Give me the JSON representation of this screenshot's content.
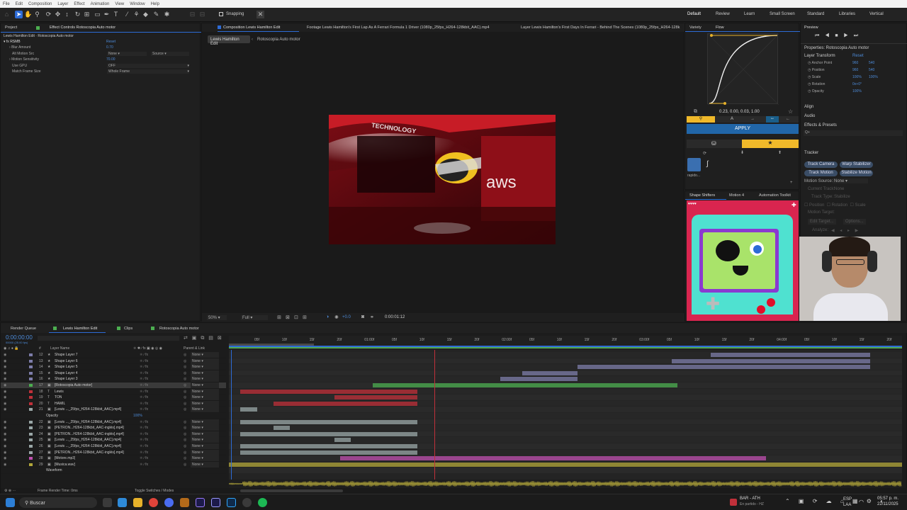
{
  "menu": [
    "File",
    "Edit",
    "Composition",
    "Layer",
    "Effect",
    "Animation",
    "View",
    "Window",
    "Help"
  ],
  "toolbar": {
    "snapping_label": "Snapping"
  },
  "workspaces": [
    "Default",
    "Review",
    "Learn",
    "Small Screen",
    "Standard",
    "Libraries",
    "Vertical"
  ],
  "project_panel": {
    "tab_project": "Project",
    "tab_effect_controls": "Effect Controls Rotoscopia Auto motor",
    "header": "Lewis Hamilton Edit · Rotoscopia Auto motor",
    "effect_name": "RSMB",
    "reset_label": "Reset",
    "props": [
      {
        "name": "Blur Amount",
        "value": "0.70"
      },
      {
        "name": "Alt Motion Src",
        "value": "None",
        "value2": "Source"
      },
      {
        "name": "Motion Sensitivity",
        "value": "70.00"
      },
      {
        "name": "Use GPU",
        "value": "OFF"
      },
      {
        "name": "Match Frame Size",
        "value": "Whole Frame"
      }
    ]
  },
  "comp_panel": {
    "tabs": [
      "Composition Lewis Hamilton Edit",
      "Footage Lewis Hamilton's First Lap As A Ferrari Formula 1 Driver (1080p_25fps_H264-128kbit_AAC).mp4",
      "Layer Lewis Hamilton's First Days In Ferrari - Behind The Scenes (1080p_25fps_H264-128k"
    ],
    "sub_tabs": [
      "Lewis Hamilton Edit",
      "Rotoscopia Auto motor"
    ],
    "image_text_top": "TECHNOLOGY",
    "image_text_logo": "aws",
    "zoom": "50%",
    "quality": "Full",
    "exposure": "+0.0",
    "timecode": "0:00:01:12"
  },
  "flow_panel": {
    "tabs": [
      "Variety",
      "Flow"
    ],
    "curve_values": "0.23, 0.00, 0.03, 1.00",
    "apply_label": "APPLY",
    "preset_label": "rapido...",
    "bottom_tabs": [
      "Shape Shifters",
      "Motion 4",
      "Automation Toolkit"
    ]
  },
  "preview_panel": {
    "tab_preview": "Preview",
    "properties_title": "Properties: Rotoscopia Auto motor",
    "layer_transform": "Layer Transform",
    "reset_label": "Reset",
    "transform": [
      {
        "name": "Anchor Point",
        "v1": "960",
        "v2": "540"
      },
      {
        "name": "Position",
        "v1": "960",
        "v2": "540"
      },
      {
        "name": "Scale",
        "v1": "100%",
        "v2": "100%"
      },
      {
        "name": "Rotation",
        "v1": "0x+0°",
        "v2": ""
      },
      {
        "name": "Opacity",
        "v1": "100%",
        "v2": ""
      }
    ],
    "sections": [
      "Align",
      "Audio",
      "Effects & Presets"
    ],
    "search_placeholder": "Q+",
    "tracker_title": "Tracker",
    "tracker_buttons": [
      "Track Camera",
      "Warp Stabilizer",
      "Track Motion",
      "Stabilize Motion"
    ],
    "motion_source_label": "Motion Source:",
    "motion_source_value": "None",
    "current_track_label": "Current Track:",
    "current_track_value": "None",
    "track_type_label": "Track Type:",
    "track_type_value": "Stabilize",
    "checks": [
      "Position",
      "Rotation",
      "Scale"
    ],
    "motion_target": "Motion Target:",
    "edit_target": "Edit Target...",
    "options": "Options...",
    "analyze": "Analyze:"
  },
  "timeline": {
    "tabs": [
      "Render Queue",
      "Lewis Hamilton Edit",
      "Clips",
      "Rotoscopia Auto motor"
    ],
    "timecode": "0:00:00:00",
    "timecode_sub": "00000 (25.00 fps)",
    "col_layer": "Layer Name",
    "col_parent": "Parent & Link",
    "ruler": [
      "05f",
      "10f",
      "15f",
      "20f",
      "01:00f",
      "05f",
      "10f",
      "15f",
      "20f",
      "02:00f",
      "05f",
      "10f",
      "15f",
      "20f",
      "03:00f",
      "05f",
      "10f",
      "15f",
      "20f",
      "04:00f",
      "05f",
      "10f",
      "15f",
      "20f"
    ],
    "layers": [
      {
        "num": "12",
        "icon": "★",
        "name": "Shape Layer 7",
        "parent": "None",
        "color": "#7d7daa"
      },
      {
        "num": "13",
        "icon": "★",
        "name": "Shape Layer 6",
        "parent": "None",
        "color": "#7d7daa"
      },
      {
        "num": "14",
        "icon": "★",
        "name": "Shape Layer 5",
        "parent": "None",
        "color": "#7d7daa"
      },
      {
        "num": "15",
        "icon": "★",
        "name": "Shape Layer 4",
        "parent": "None",
        "color": "#7d7daa"
      },
      {
        "num": "16",
        "icon": "★",
        "name": "Shape Layer 3",
        "parent": "None",
        "color": "#7d7daa"
      },
      {
        "num": "17",
        "icon": "▣",
        "name": "[Rotoscopia Auto motor]",
        "parent": "None",
        "color": "#4caf50"
      },
      {
        "num": "18",
        "icon": "T",
        "name": "Lewis",
        "parent": "None",
        "color": "#c0303a"
      },
      {
        "num": "19",
        "icon": "T",
        "name": "TON",
        "parent": "None",
        "color": "#c0303a"
      },
      {
        "num": "20",
        "icon": "T",
        "name": "HAMIL",
        "parent": "None",
        "color": "#c0303a"
      },
      {
        "num": "21",
        "icon": "▣",
        "name": "[Lewis ..._25fps_H264-128kbit_AAC].mp4]",
        "parent": "None",
        "color": "#9aa7a7"
      },
      {
        "num": "",
        "icon": "",
        "name": "Opacity",
        "parent": "",
        "color": ""
      },
      {
        "num": "22",
        "icon": "▣",
        "name": "[Lewis ..._25fps_H264-128kbit_AAC].mp4]",
        "parent": "None",
        "color": "#9aa7a7"
      },
      {
        "num": "23",
        "icon": "▣",
        "name": "[PETRON...H264-128kbit_AAC-inglés].mp4]",
        "parent": "None",
        "color": "#9aa7a7"
      },
      {
        "num": "24",
        "icon": "▣",
        "name": "[PETRON...H264-128kbit_AAC-inglés].mp4]",
        "parent": "None",
        "color": "#9aa7a7"
      },
      {
        "num": "25",
        "icon": "▣",
        "name": "[Lewis ..._25fps_H264-128kbit_AAC].mp4]",
        "parent": "None",
        "color": "#9aa7a7"
      },
      {
        "num": "26",
        "icon": "▣",
        "name": "[Lewis ..._25fps_H264-128kbit_AAC].mp4]",
        "parent": "None",
        "color": "#9aa7a7"
      },
      {
        "num": "27",
        "icon": "▣",
        "name": "[PETRON...H264-128kbit_AAC-inglés].mp4]",
        "parent": "None",
        "color": "#9aa7a7"
      },
      {
        "num": "28",
        "icon": "▣",
        "name": "[Motore.mp3]",
        "parent": "None",
        "color": "#c04fb0"
      },
      {
        "num": "29",
        "icon": "▣",
        "name": "[Musica.wav]",
        "parent": "None",
        "color": "#b3a73a"
      },
      {
        "num": "",
        "icon": "",
        "name": "Waveform",
        "parent": "",
        "color": ""
      }
    ],
    "opacity_value": "100%",
    "footer_left": "Frame Render Time: 0ms",
    "footer_mid": "Toggle Switches / Modes"
  },
  "taskbar": {
    "search": "Buscar",
    "weather_title": "BAR - ATH",
    "weather_sub": "En partido - HZ",
    "lang1": "ESP",
    "lang2": "LAA",
    "time": "05:57 p. m.",
    "date": "22/11/2025"
  }
}
